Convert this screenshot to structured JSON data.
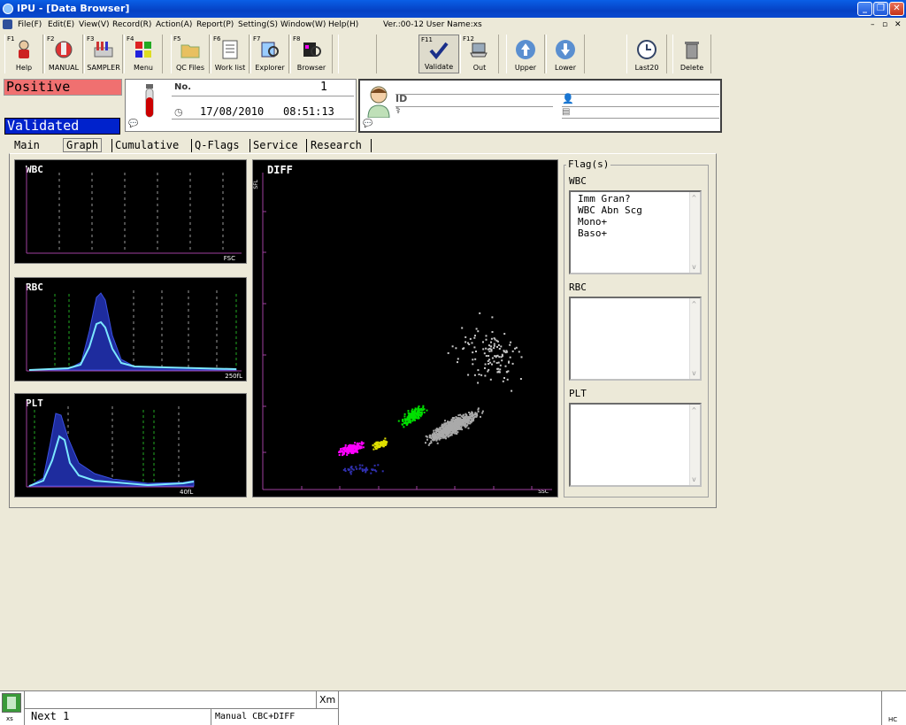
{
  "window": {
    "title": "IPU - [Data Browser]"
  },
  "menu": {
    "items": [
      "File(F)",
      "Edit(E)",
      "View(V)",
      "Record(R)",
      "Action(A)",
      "Report(P)",
      "Setting(S)",
      "Window(W)",
      "Help(H)"
    ],
    "version": "Ver.:00-12 User Name:xs"
  },
  "toolbar": {
    "buttons": [
      {
        "key": "F1",
        "label": "Help"
      },
      {
        "key": "F2",
        "label": "MANUAL"
      },
      {
        "key": "F3",
        "label": "SAMPLER"
      },
      {
        "key": "F4",
        "label": "Menu"
      },
      {
        "key": "F5",
        "label": "QC Files"
      },
      {
        "key": "F6",
        "label": "Work list"
      },
      {
        "key": "F7",
        "label": "Explorer"
      },
      {
        "key": "F8",
        "label": "Browser"
      },
      {
        "key": "F11",
        "label": "Validate"
      },
      {
        "key": "F12",
        "label": "Out"
      },
      {
        "key": "",
        "label": "Upper"
      },
      {
        "key": "",
        "label": "Lower"
      },
      {
        "key": "",
        "label": "Last20"
      },
      {
        "key": "",
        "label": "Delete"
      }
    ]
  },
  "status": {
    "positive": "Positive",
    "validated": "Validated"
  },
  "sample": {
    "no_label": "No.",
    "no_value": "1",
    "date": "17/08/2010",
    "time": "08:51:13"
  },
  "patient": {
    "id_label": "ID"
  },
  "tabs": [
    "Main",
    "Graph",
    "Cumulative",
    "Q-Flags",
    "Service",
    "Research"
  ],
  "graphs": {
    "wbc": {
      "title": "WBC",
      "axis": "FSC"
    },
    "rbc": {
      "title": "RBC",
      "axis": "250fL"
    },
    "plt": {
      "title": "PLT",
      "axis": "40fL"
    },
    "diff": {
      "title": "DIFF",
      "xaxis": "SSC",
      "yaxis": "SFL"
    }
  },
  "flags": {
    "title": "Flag(s)",
    "wbc_label": "WBC",
    "wbc_items": [
      "Imm Gran?",
      "WBC Abn Scg",
      "Mono+",
      "Baso+"
    ],
    "rbc_label": "RBC",
    "plt_label": "PLT"
  },
  "bottom": {
    "user": "xs",
    "next": "Next 1",
    "mode": "Manual CBC+DIFF",
    "xm": "Xm",
    "hc": "HC"
  },
  "colors": {
    "positive_bg": "#F07070",
    "validated_bg": "#0022CC",
    "neut": "#AAAAAA",
    "lymph": "#FF00FF",
    "mono": "#00E000",
    "eos": "#E0E000"
  }
}
